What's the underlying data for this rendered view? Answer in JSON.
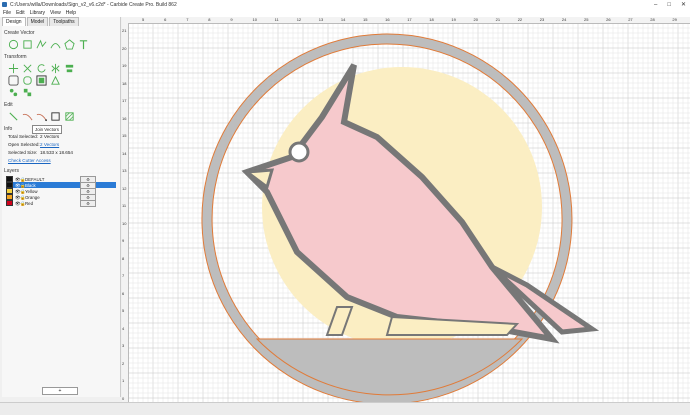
{
  "window": {
    "title": "C:/Users/willa/Downloads/Sign_v2_v6.c2d* - Carbide Create Pro. Build 862"
  },
  "menu": [
    "File",
    "Edit",
    "Library",
    "View",
    "Help"
  ],
  "tabs": [
    "Design",
    "Model",
    "Toolpaths"
  ],
  "sections": {
    "create_vector": "Create Vector",
    "transform": "Transform",
    "edit": "Edit",
    "info": "Info",
    "layers": "Layers"
  },
  "tooltip": "Join Vectors",
  "info": {
    "total_selected_label": "Total Selected:",
    "total_selected_value": "2 Vectors",
    "open_selected_label": "Open Selected:",
    "open_selected_value": "2 Vectors",
    "selected_size_label": "Selected Size:",
    "selected_size_value": "18.533 x 18.654",
    "check_link": "Check Cutter Access"
  },
  "layers": [
    {
      "name": "DEFAULT",
      "color": "#111111"
    },
    {
      "name": "Black",
      "color": "#111111",
      "selected": true
    },
    {
      "name": "Yellow",
      "color": "#f4d03f"
    },
    {
      "name": "Orange",
      "color": "#f5a623"
    },
    {
      "name": "Red",
      "color": "#d0021b"
    }
  ],
  "add_layer": "+",
  "ruler": {
    "h": [
      "5",
      "6",
      "7",
      "8",
      "9",
      "10",
      "11",
      "12",
      "13",
      "14",
      "15",
      "16",
      "17",
      "18",
      "19",
      "20",
      "21",
      "22",
      "23",
      "24",
      "25",
      "26",
      "27",
      "28",
      "29"
    ],
    "v": [
      "21",
      "20",
      "19",
      "18",
      "17",
      "16",
      "15",
      "14",
      "13",
      "12",
      "11",
      "10",
      "9",
      "8",
      "7",
      "6",
      "5",
      "4",
      "3",
      "2",
      "1",
      "0"
    ]
  },
  "colors": {
    "accent": "#2a7bd6",
    "grid": "#d4d4d4",
    "yellow": "#fbeec3",
    "red": "#f6c9cc",
    "gray": "#bdbdbd",
    "outline": "#e07b39"
  }
}
